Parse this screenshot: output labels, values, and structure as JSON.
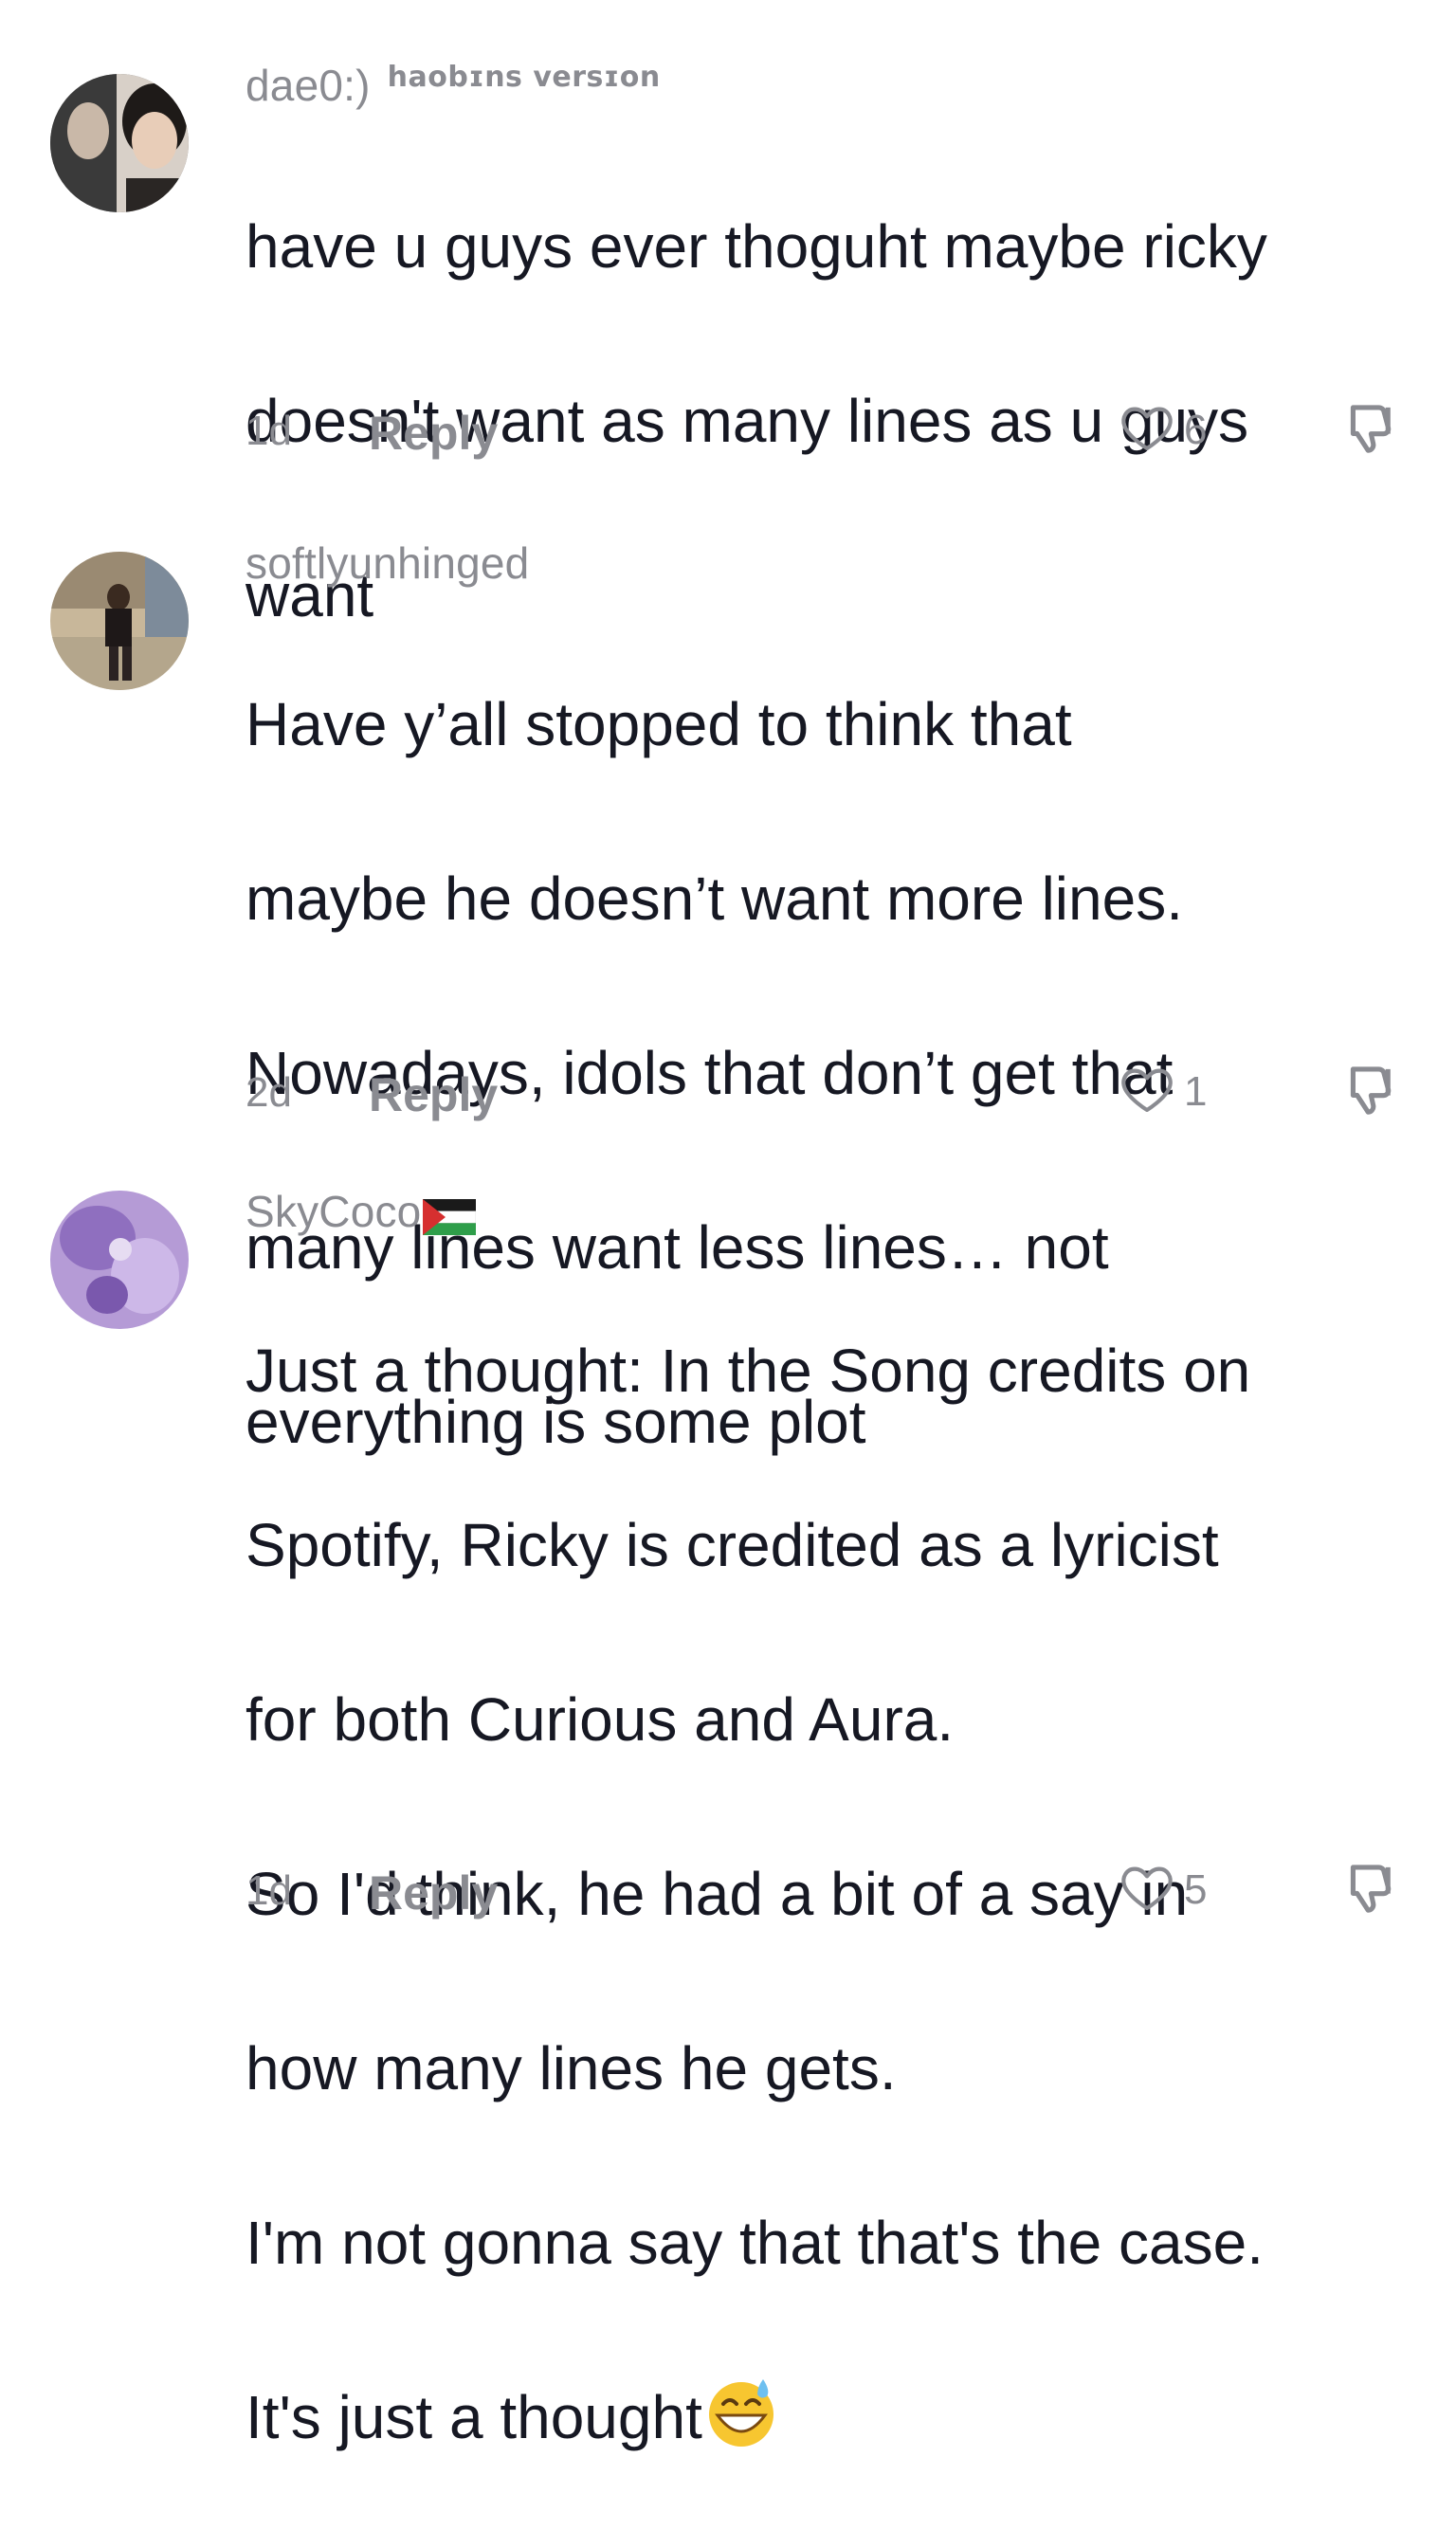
{
  "comments": [
    {
      "username": "dae0:)",
      "handle_extra": "haobɪns versɪon",
      "text_lines": [
        "have u guys ever thoguht maybe ricky",
        "doesn't want as many lines as u guys",
        "want"
      ],
      "timestamp": "1d",
      "reply_label": "Reply",
      "likes": "6"
    },
    {
      "username": "softlyunhinged",
      "text_lines": [
        "Have y’all stopped to think that",
        "maybe he doesn’t want more lines.",
        "Nowadays, idols that don’t get that",
        "many lines want less lines… not",
        "everything is some plot"
      ],
      "timestamp": "2d",
      "reply_label": "Reply",
      "likes": "1"
    },
    {
      "username": "SkyCoco",
      "flag_icon": "palestine-flag-icon",
      "text_lines": [
        "Just a thought: In the Song credits on",
        "Spotify, Ricky is credited as a lyricist",
        "for both Curious and Aura.",
        "So I'd think, he had a bit of a say in",
        "how many lines he gets.",
        "I'm not gonna say that that's the case.",
        "It's just a thought"
      ],
      "emoji_icon": "grinning-sweat-emoji-icon",
      "timestamp": "1d",
      "reply_label": "Reply",
      "likes": "5"
    }
  ],
  "colors": {
    "text": "#161823",
    "secondary": "#8a8b91",
    "background": "#ffffff"
  }
}
